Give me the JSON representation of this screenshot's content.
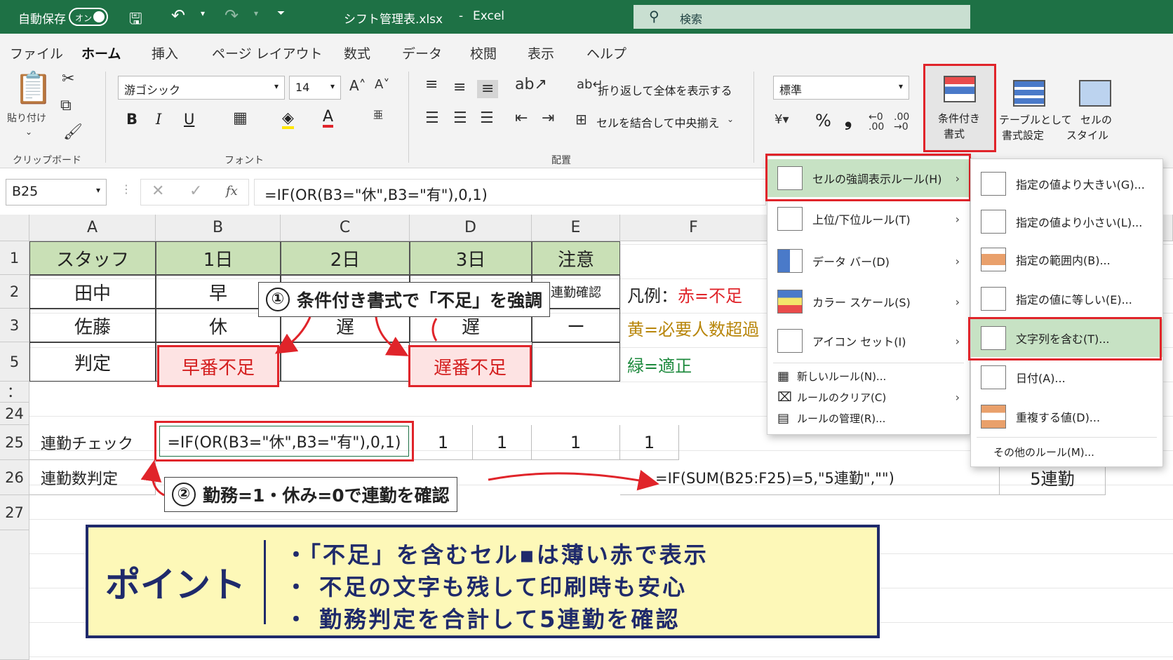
{
  "titlebar": {
    "autosave": "自動保存",
    "autosave_state": "オン",
    "filename": "シフト管理表.xlsx",
    "separator": "-",
    "app": "Excel",
    "search": "検索"
  },
  "menu": [
    "ファイル",
    "ホーム",
    "挿入",
    "ページ レイアウト",
    "数式",
    "データ",
    "校閲",
    "表示",
    "ヘルプ"
  ],
  "ribbon": {
    "paste": "貼り付け",
    "clipboard": "クリップボード",
    "font_name": "游ゴシック",
    "font_size": "14",
    "font_group": "フォント",
    "bold": "B",
    "italic": "I",
    "underline": "U",
    "wrap": "折り返して全体を表示する",
    "merge": "セルを結合して中央揃え",
    "align_group": "配置",
    "number_format": "標準",
    "percent": "%",
    "comma": "❟",
    "cond_fmt_1": "条件付き",
    "cond_fmt_2": "書式",
    "table_1": "テーブルとして",
    "table_2": "書式設定",
    "cellstyle_1": "セルの",
    "cellstyle_2": "スタイル"
  },
  "formula_bar": {
    "name_box": "B25",
    "fx": "fx",
    "formula": "=IF(OR(B3=\"休\",B3=\"有\"),0,1)"
  },
  "columns": [
    "A",
    "B",
    "C",
    "D",
    "E",
    "F"
  ],
  "rows": [
    "1",
    "2",
    "3",
    "5",
    "：",
    "24",
    "25",
    "26",
    "27"
  ],
  "table": {
    "headers": [
      "スタッフ",
      "1日",
      "2日",
      "3日",
      "注意"
    ],
    "r2": [
      "田中",
      "早",
      "連勤確認"
    ],
    "r3": [
      "佐藤",
      "休",
      "遅",
      "遅",
      "ー"
    ],
    "r5": [
      "判定",
      "早番不足",
      "遅番不足"
    ],
    "r25": [
      "連勤チェック",
      "=IF(OR(B3=\"休\",B3=\"有\"),0,1)",
      "1",
      "1",
      "1",
      "1"
    ],
    "r26": [
      "連勤数判定",
      "=IF(SUM(B25:F25)=5,\"5連勤\",\"\")",
      "5連勤"
    ]
  },
  "legend": {
    "l1a": "凡例：",
    "l1b": "赤=不足",
    "l2": "黄=必要人数超過",
    "l3": "緑=適正",
    "red": "#e0242a",
    "yellow": "#b8860b",
    "green": "#1e8a3e"
  },
  "callouts": {
    "c1_num": "①",
    "c1": "条件付き書式で「不足」を強調",
    "c2_num": "②",
    "c2": "勤務=1・休み=0で連勤を確認"
  },
  "menu1": [
    "セルの強調表示ルール(H)",
    "上位/下位ルール(T)",
    "データ バー(D)",
    "カラー スケール(S)",
    "アイコン セット(I)",
    "新しいルール(N)...",
    "ルールのクリア(C)",
    "ルールの管理(R)..."
  ],
  "menu2": [
    "指定の値より大きい(G)...",
    "指定の値より小さい(L)...",
    "指定の範囲内(B)...",
    "指定の値に等しい(E)...",
    "文字列を含む(T)...",
    "日付(A)...",
    "重複する値(D)...",
    "その他のルール(M)..."
  ],
  "point": {
    "title": "ポイント",
    "b1": "・「不足」を含むセル▪は薄い赤で表示",
    "b2": "・ 不足の文字も残して印刷時も安心",
    "b3": "・ 勤務判定を合計して5連勤を確認"
  }
}
